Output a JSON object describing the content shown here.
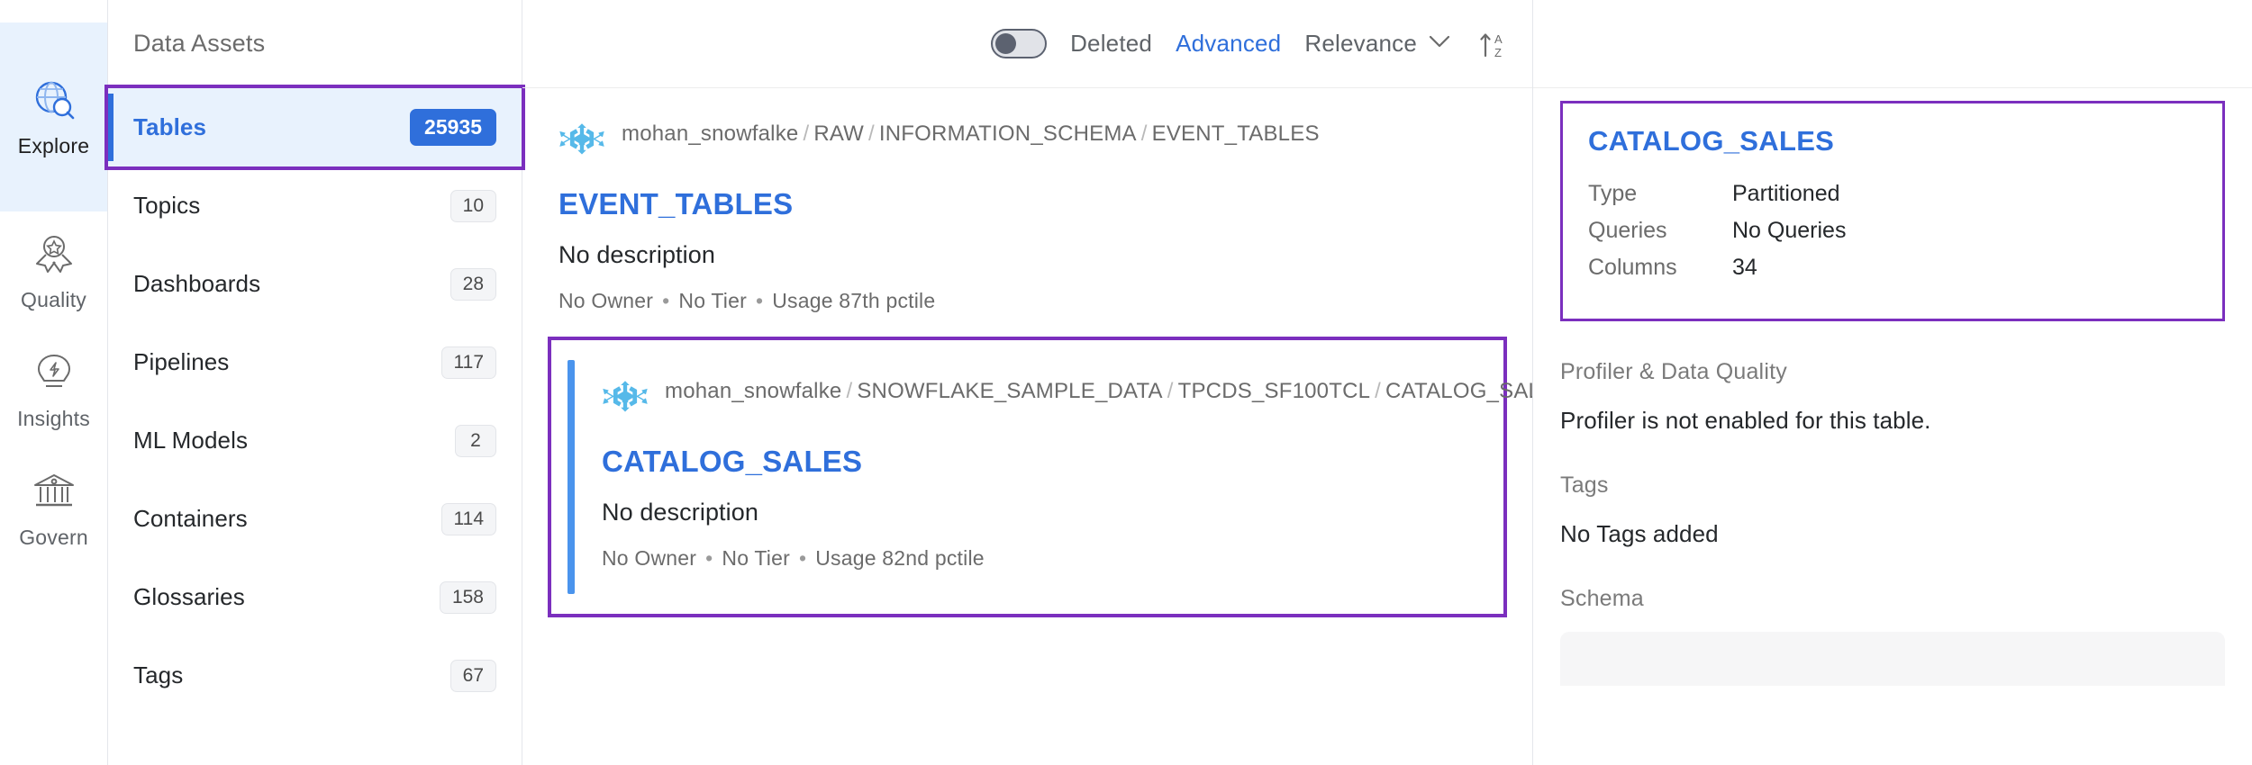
{
  "rail": {
    "items": [
      {
        "label": "Explore",
        "icon": "globe-search-icon",
        "active": true
      },
      {
        "label": "Quality",
        "icon": "quality-badge-icon",
        "active": false
      },
      {
        "label": "Insights",
        "icon": "lightbulb-icon",
        "active": false
      },
      {
        "label": "Govern",
        "icon": "bank-icon",
        "active": false
      }
    ]
  },
  "facets": {
    "title": "Data Assets",
    "items": [
      {
        "label": "Tables",
        "count": "25935",
        "active": true
      },
      {
        "label": "Topics",
        "count": "10",
        "active": false
      },
      {
        "label": "Dashboards",
        "count": "28",
        "active": false
      },
      {
        "label": "Pipelines",
        "count": "117",
        "active": false
      },
      {
        "label": "ML Models",
        "count": "2",
        "active": false
      },
      {
        "label": "Containers",
        "count": "114",
        "active": false
      },
      {
        "label": "Glossaries",
        "count": "158",
        "active": false
      },
      {
        "label": "Tags",
        "count": "67",
        "active": false
      }
    ]
  },
  "toolbar": {
    "deleted_label": "Deleted",
    "deleted_toggle_state": "off",
    "advanced_label": "Advanced",
    "sort_by_label": "Relevance",
    "sort_order_icon": "sort-ascending-az-icon"
  },
  "results": [
    {
      "source_icon": "snowflake-icon",
      "breadcrumb": [
        "mohan_snowfalke",
        "RAW",
        "INFORMATION_SCHEMA",
        "EVENT_TABLES"
      ],
      "title": "EVENT_TABLES",
      "description": "No description",
      "owner": "No Owner",
      "tier": "No Tier",
      "usage": "Usage 87th pctile",
      "highlighted": false
    },
    {
      "source_icon": "snowflake-icon",
      "breadcrumb": [
        "mohan_snowfalke",
        "SNOWFLAKE_SAMPLE_DATA",
        "TPCDS_SF100TCL",
        "CATALOG_SALES"
      ],
      "title": "CATALOG_SALES",
      "description": "No description",
      "owner": "No Owner",
      "tier": "No Tier",
      "usage": "Usage 82nd pctile",
      "highlighted": true
    }
  ],
  "side_panel": {
    "title": "CATALOG_SALES",
    "summary": [
      {
        "key": "Type",
        "value": "Partitioned"
      },
      {
        "key": "Queries",
        "value": "No Queries"
      },
      {
        "key": "Columns",
        "value": "34"
      }
    ],
    "profiler_label": "Profiler & Data Quality",
    "profiler_value": "Profiler is not enabled for this table.",
    "tags_label": "Tags",
    "tags_value": "No Tags added",
    "schema_label": "Schema"
  },
  "colors": {
    "accent_blue": "#2f6fdb",
    "highlight_purple": "#7b2fbe",
    "snowflake_blue": "#56b9e9",
    "active_bg": "#e8f2fd",
    "muted_text": "#6b6b6b"
  }
}
